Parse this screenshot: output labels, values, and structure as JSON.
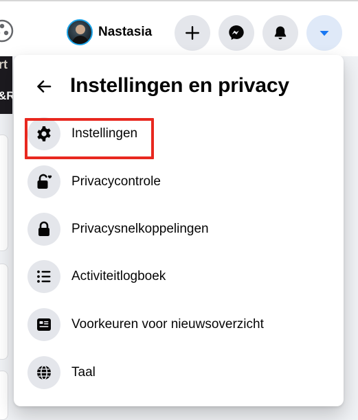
{
  "topbar": {
    "profile_name": "Nastasia",
    "buttons": [
      {
        "name": "create",
        "icon": "plus-icon"
      },
      {
        "name": "messenger",
        "icon": "messenger-icon"
      },
      {
        "name": "notifications",
        "icon": "bell-icon"
      },
      {
        "name": "account",
        "icon": "caret-down-icon",
        "active": true
      }
    ]
  },
  "background": {
    "thumb_text_top": "rt",
    "thumb_text_bottom": "&R"
  },
  "panel": {
    "title": "Instellingen en privacy",
    "items": [
      {
        "label": "Instellingen",
        "icon": "gear-icon",
        "highlighted": true
      },
      {
        "label": "Privacycontrole",
        "icon": "lock-heart-icon"
      },
      {
        "label": "Privacysnelkoppelingen",
        "icon": "lock-icon"
      },
      {
        "label": "Activiteitlogboek",
        "icon": "list-icon"
      },
      {
        "label": "Voorkeuren voor nieuwsoverzicht",
        "icon": "news-feed-icon"
      },
      {
        "label": "Taal",
        "icon": "globe-icon"
      }
    ]
  },
  "colors": {
    "accent": "#1877f2",
    "highlight": "#e8281f",
    "icon_bg": "#e4e6eb"
  }
}
